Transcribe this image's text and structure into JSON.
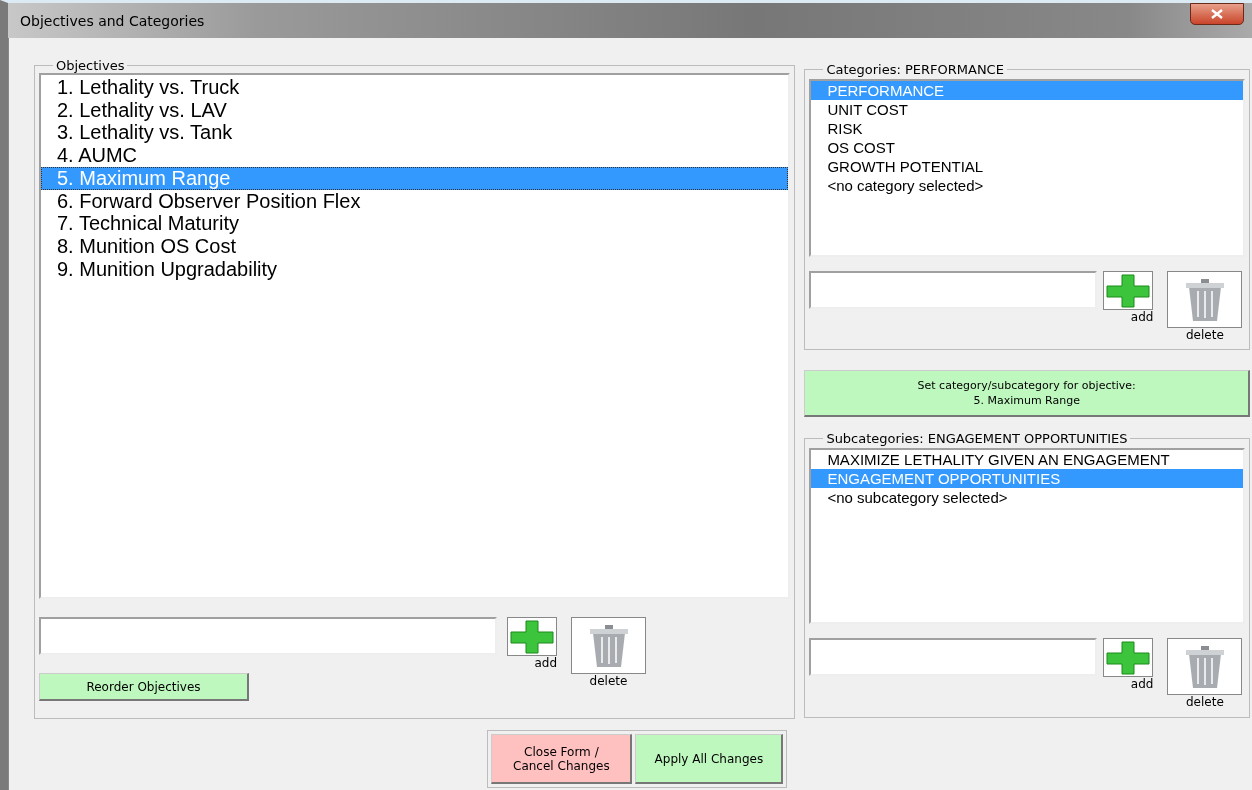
{
  "window": {
    "title": "Objectives and Categories"
  },
  "objectives": {
    "legend": "Objectives",
    "items": [
      {
        "label": "1. Lethality vs. Truck",
        "selected": false
      },
      {
        "label": "2. Lethality vs. LAV",
        "selected": false
      },
      {
        "label": "3. Lethality vs. Tank",
        "selected": false
      },
      {
        "label": "4. AUMC",
        "selected": false
      },
      {
        "label": "5. Maximum Range",
        "selected": true
      },
      {
        "label": "6. Forward Observer Position Flex",
        "selected": false
      },
      {
        "label": "7. Technical Maturity",
        "selected": false
      },
      {
        "label": "8. Munition OS Cost",
        "selected": false
      },
      {
        "label": "9. Munition Upgradability",
        "selected": false
      }
    ],
    "add_label": "add",
    "delete_label": "delete",
    "reorder_button": "Reorder Objectives"
  },
  "categories": {
    "legend": "Categories: PERFORMANCE",
    "items": [
      {
        "label": "PERFORMANCE",
        "selected": true
      },
      {
        "label": "UNIT COST",
        "selected": false
      },
      {
        "label": "RISK",
        "selected": false
      },
      {
        "label": "OS COST",
        "selected": false
      },
      {
        "label": "GROWTH POTENTIAL",
        "selected": false
      },
      {
        "label": "<no category selected>",
        "selected": false
      }
    ],
    "add_label": "add",
    "delete_label": "delete"
  },
  "set_button": {
    "line_1": "Set category/subcategory for objective:",
    "line_2": "5. Maximum Range"
  },
  "subcategories": {
    "legend": "Subcategories: ENGAGEMENT OPPORTUNITIES",
    "items": [
      {
        "label": "MAXIMIZE LETHALITY GIVEN AN ENGAGEMENT",
        "selected": false
      },
      {
        "label": "ENGAGEMENT OPPORTUNITIES",
        "selected": true
      },
      {
        "label": "<no subcategory selected>",
        "selected": false
      }
    ],
    "add_label": "add",
    "delete_label": "delete"
  },
  "buttons": {
    "close": "Close Form / Cancel Changes",
    "apply": "Apply All Changes"
  }
}
